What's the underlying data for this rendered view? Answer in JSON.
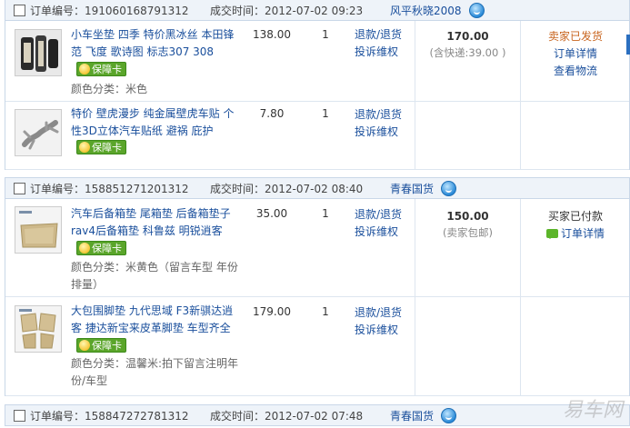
{
  "labels": {
    "order_no": "订单编号：",
    "deal_time": "成交时间：",
    "color_category": "颜色分类：",
    "refund": "退款/退货",
    "complaint": "投诉维权",
    "protection": "保障卡"
  },
  "orders": [
    {
      "order_no": "191060168791312",
      "deal_time": "2012-07-02 09:23",
      "buyer": "风平秋晓2008",
      "items": [
        {
          "title": "小车坐垫 四季 特价黑冰丝 本田锋范 飞度 歌诗图 标志307 308",
          "price": "138.00",
          "qty": "1",
          "color": "米色"
        },
        {
          "title": "特价 壁虎漫步 纯金属壁虎车贴 个性3D立体汽车贴纸 避祸 庇护",
          "price": "7.80",
          "qty": "1",
          "color": ""
        }
      ],
      "total": "170.00",
      "shipping": "(含快递:39.00 )",
      "status": "卖家已发货",
      "actions": [
        "订单详情",
        "查看物流"
      ]
    },
    {
      "order_no": "158851271201312",
      "deal_time": "2012-07-02 08:40",
      "buyer": "青春国货",
      "items": [
        {
          "title": "汽车后备箱垫 尾箱垫 后备箱垫子 rav4后备箱垫 科鲁兹 明锐逍客",
          "price": "35.00",
          "qty": "1",
          "color": "米黄色（留言车型 年份排量）"
        },
        {
          "title": "大包围脚垫 九代思域 F3新骐达逍客 捷达新宝来皮革脚垫 车型齐全",
          "price": "179.00",
          "qty": "1",
          "color": "温馨米:拍下留言注明年份/车型"
        }
      ],
      "total": "150.00",
      "shipping": "(卖家包邮)",
      "status": "买家已付款",
      "actions": [
        "订单详情"
      ]
    },
    {
      "order_no": "158847272781312",
      "deal_time": "2012-07-02 07:48",
      "buyer": "青春国货"
    }
  ],
  "watermark": "易车网"
}
